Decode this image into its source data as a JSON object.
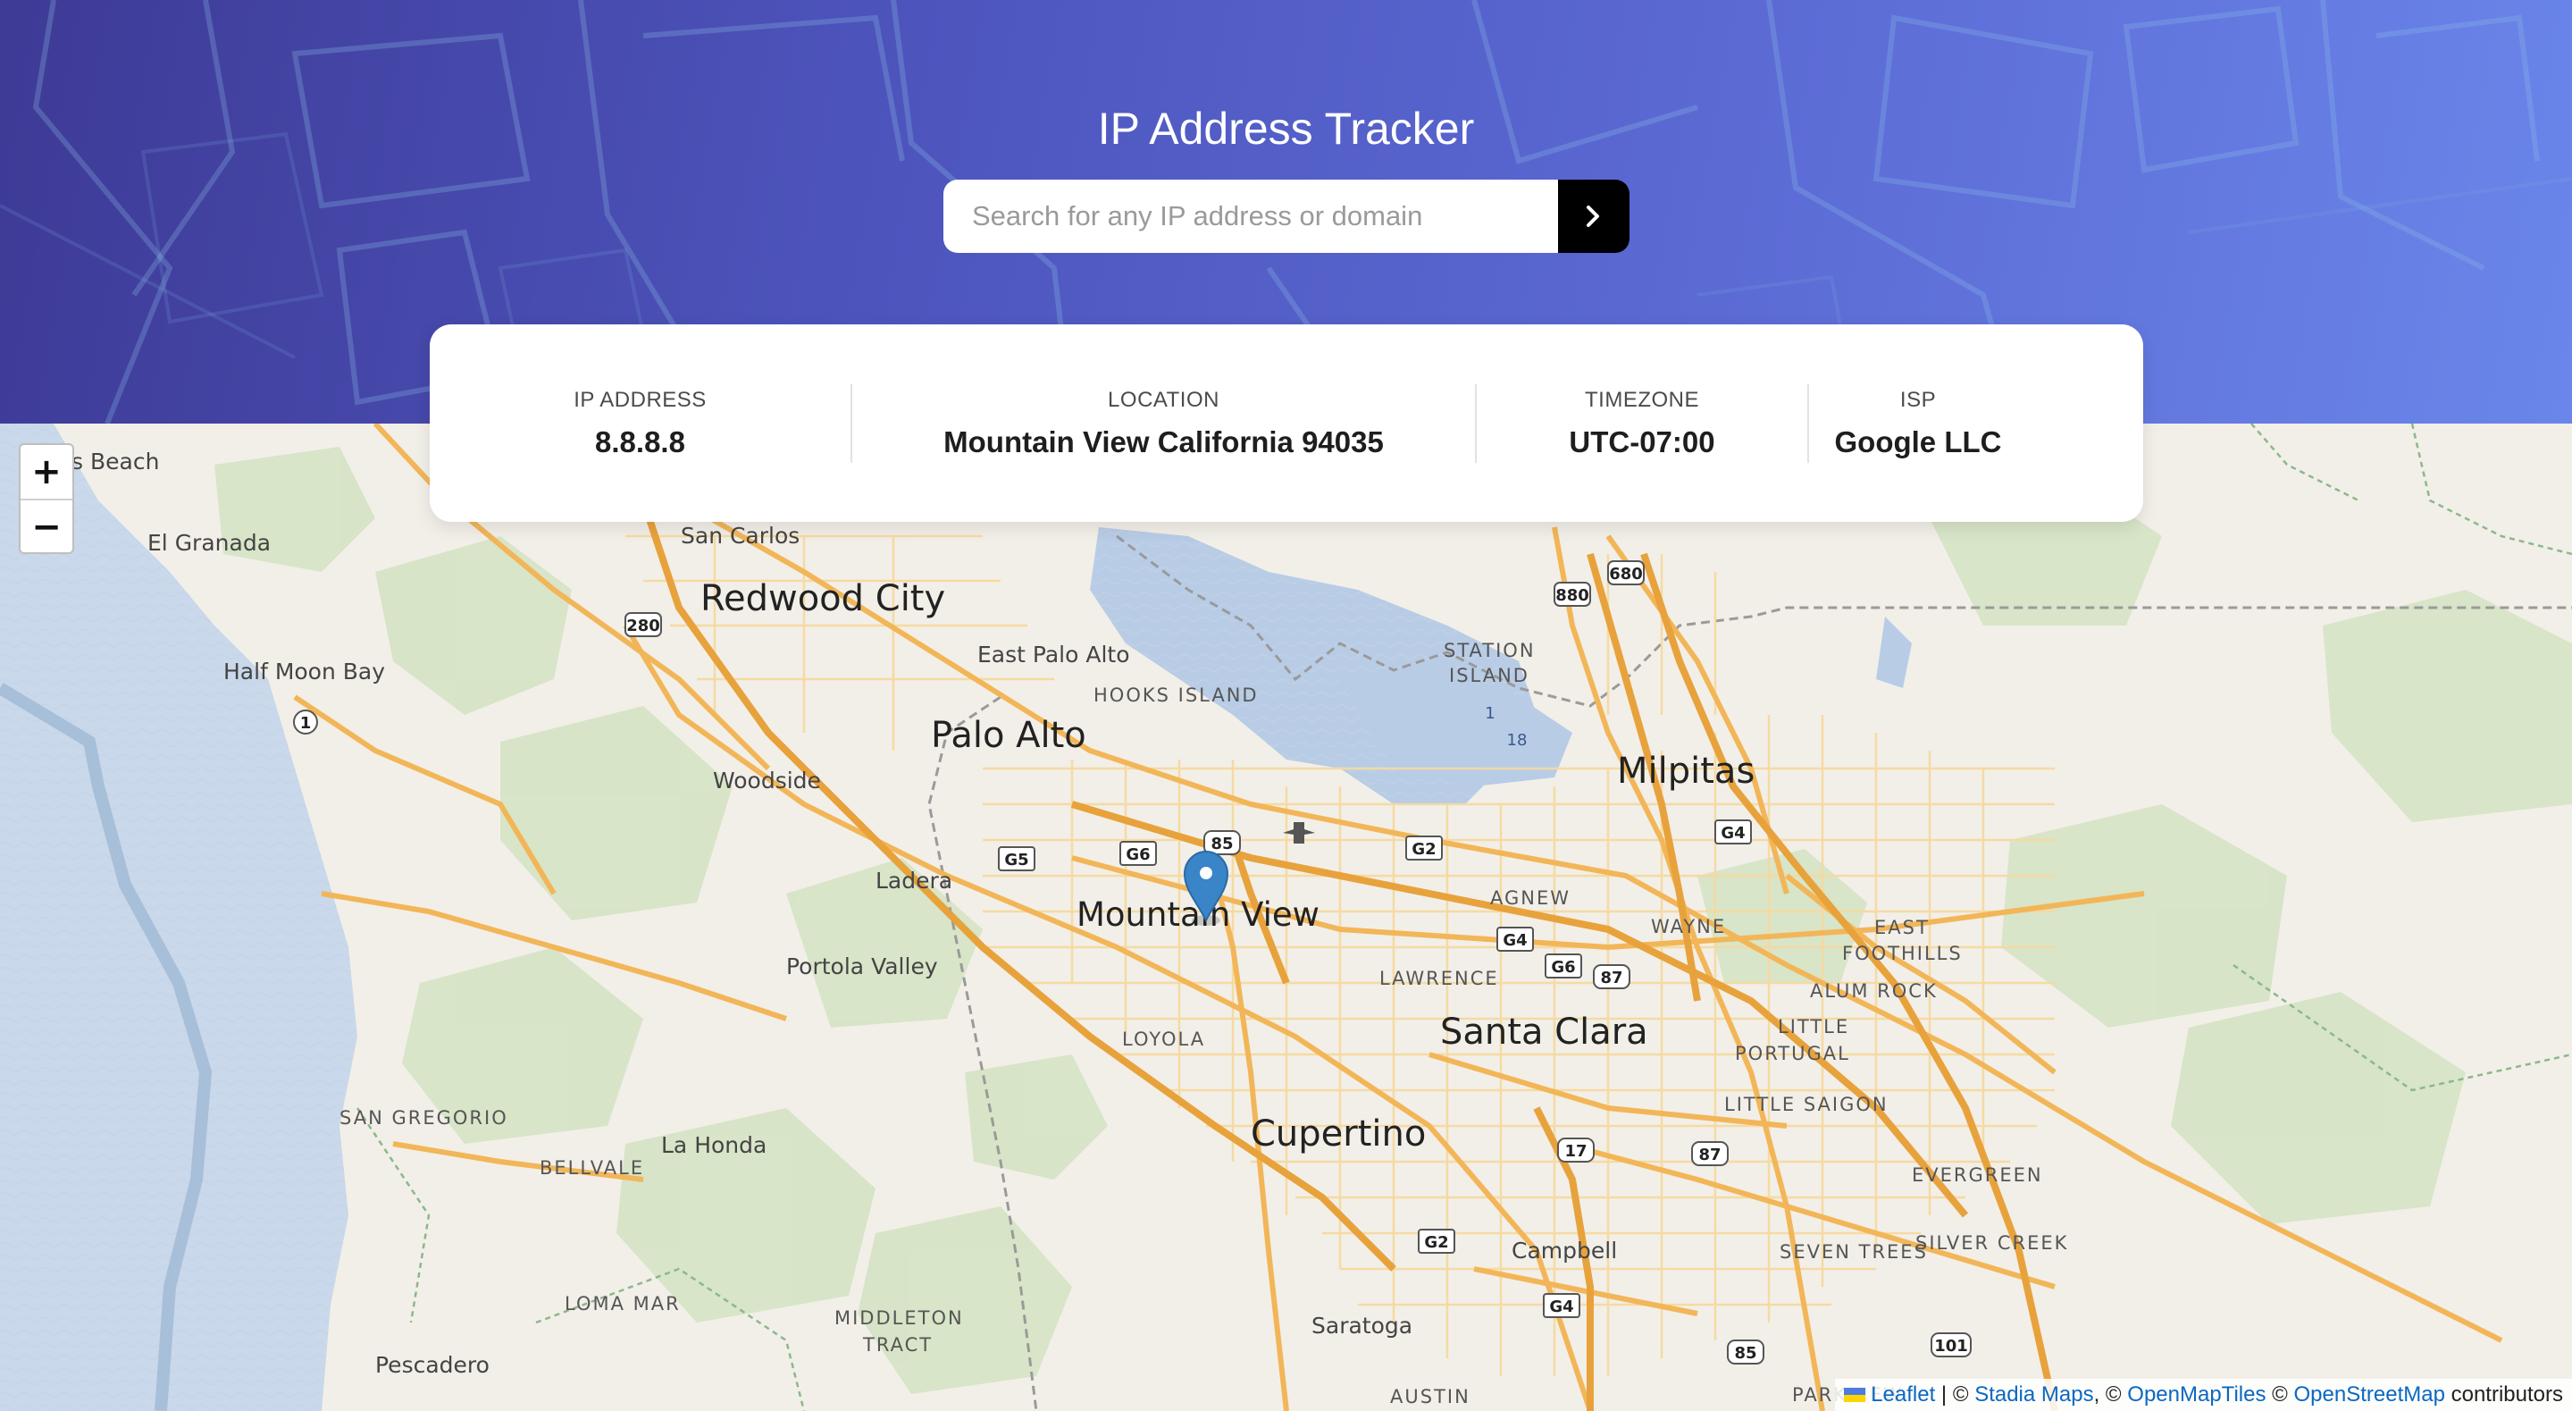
{
  "app": {
    "title": "IP Address Tracker"
  },
  "search": {
    "placeholder": "Search for any IP address or domain",
    "value": "",
    "button_icon": "chevron-right-icon"
  },
  "info": {
    "ip": {
      "label": "IP ADDRESS",
      "value": "8.8.8.8"
    },
    "location": {
      "label": "LOCATION",
      "value": "Mountain View California 94035"
    },
    "timezone": {
      "label": "TIMEZONE",
      "value": "UTC-07:00"
    },
    "isp": {
      "label": "ISP",
      "value": "Google LLC"
    }
  },
  "map": {
    "zoom_in": "+",
    "zoom_out": "−",
    "marker_icon": "map-pin-icon",
    "labels": {
      "beach": "s Beach",
      "el_granada": "El Granada",
      "san_carlos": "San Carlos",
      "redwood_city": "Redwood City",
      "half_moon_bay": "Half Moon Bay",
      "east_palo_alto": "East Palo Alto",
      "hooks_island": "HOOKS ISLAND",
      "station_island": "STATION",
      "station_island_2": "ISLAND",
      "palo_alto": "Palo Alto",
      "milpitas": "Milpitas",
      "woodside": "Woodside",
      "ladera": "Ladera",
      "mountain_view": "Mountain View",
      "agnew": "AGNEW",
      "wayne": "WAYNE",
      "east_foothills": "EAST",
      "east_foothills_2": "FOOTHILLS",
      "alum_rock": "ALUM ROCK",
      "portola_valley": "Portola Valley",
      "lawrence": "LAWRENCE",
      "santa_clara": "Santa Clara",
      "little_portugal": "LITTLE",
      "little_portugal_2": "PORTUGAL",
      "loyola": "LOYOLA",
      "little_saigon": "LITTLE SAIGON",
      "san_gregorio": "SAN GREGORIO",
      "cupertino": "Cupertino",
      "la_honda": "La Honda",
      "bellvale": "BELLVALE",
      "evergreen": "EVERGREEN",
      "campbell": "Campbell",
      "seven_trees": "SEVEN TREES",
      "silver_creek": "SILVER CREEK",
      "loma_mar": "LOMA MAR",
      "middleton_tract": "MIDDLETON",
      "middleton_tract_2": "TRACT",
      "saratoga": "Saratoga",
      "pescadero": "Pescadero",
      "parkview": "PARKVIEW",
      "austin": "AUSTIN"
    },
    "shields": {
      "i280": "280",
      "i880": "880",
      "i680": "680",
      "r1": "1",
      "r85": "85",
      "g6": "G6",
      "g5": "G5",
      "g2": "G2",
      "g4": "G4",
      "g6b": "G6",
      "r87": "87",
      "r17": "17",
      "r87b": "87",
      "g2b": "G2",
      "g4b": "G4",
      "r85b": "85",
      "r101": "101",
      "g4c": "G4",
      "b1": "1",
      "b18": "18"
    },
    "attribution": {
      "leaflet": "Leaflet",
      "sep1": " | © ",
      "stadia": "Stadia Maps",
      "sep2": ", © ",
      "omt": "OpenMapTiles",
      "sep3": " © ",
      "osm": "OpenStreetMap",
      "suffix": " contributors"
    }
  }
}
